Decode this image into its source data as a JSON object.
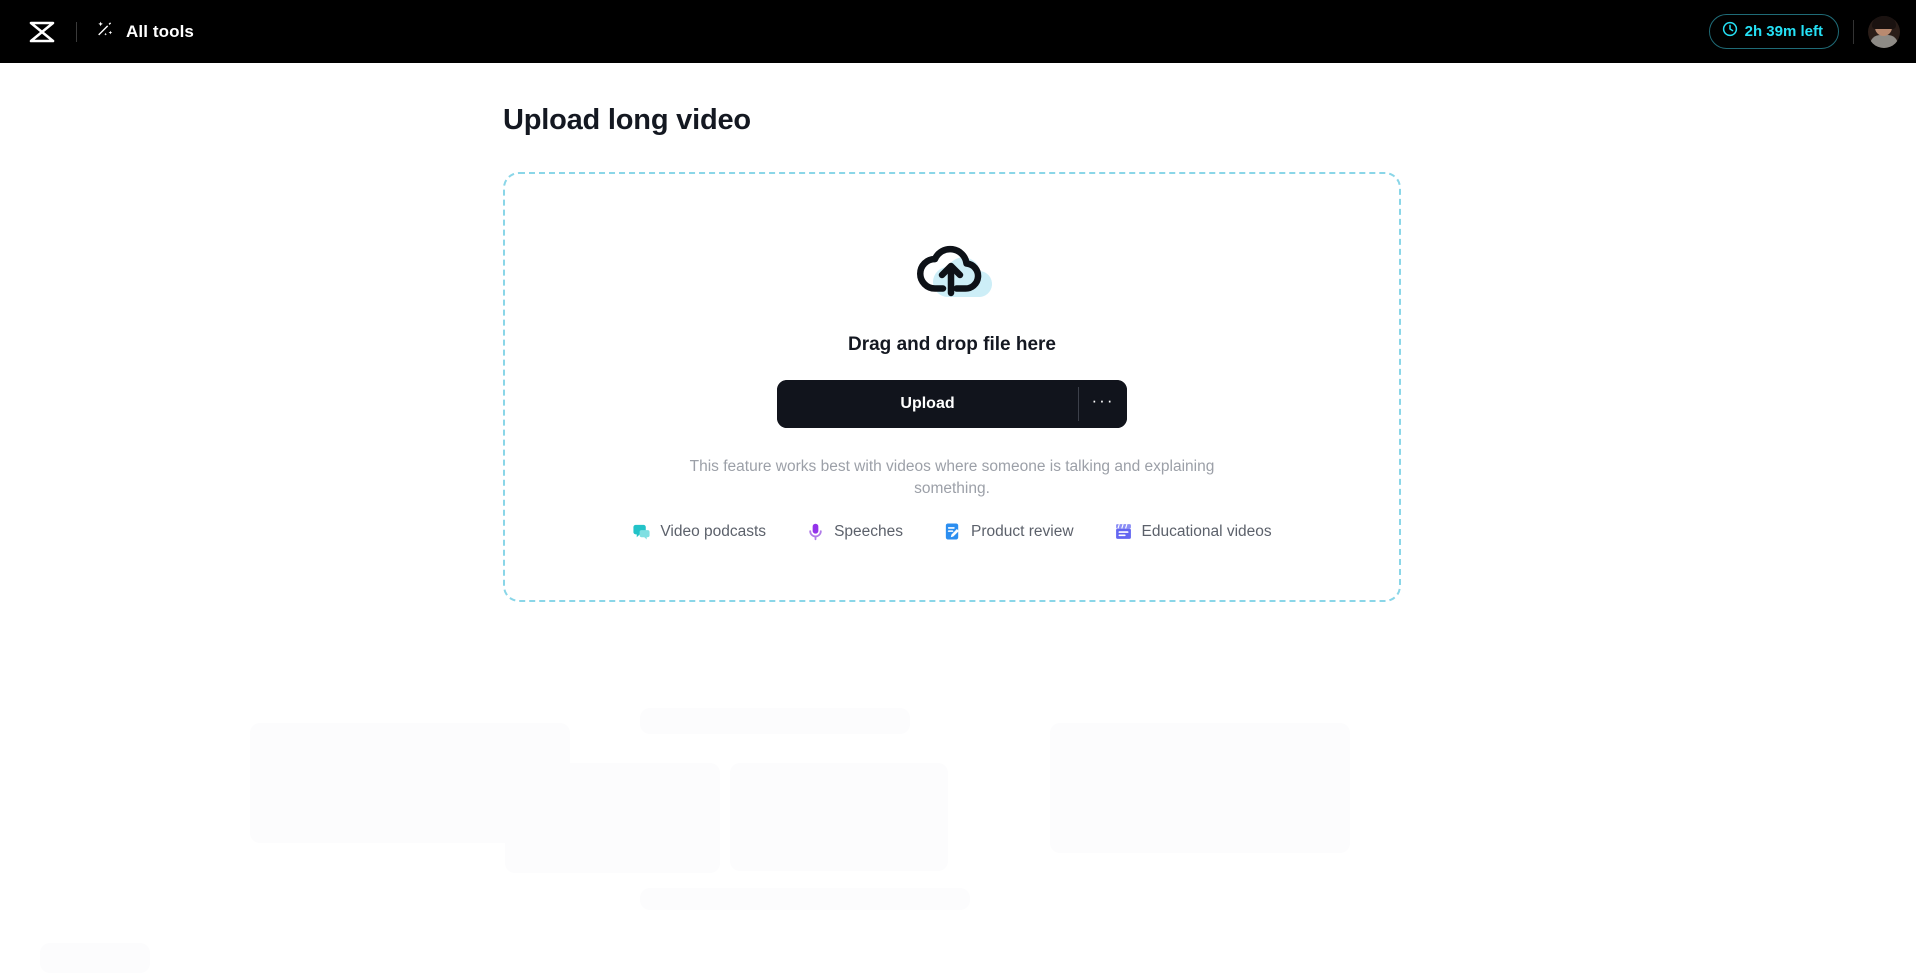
{
  "topbar": {
    "logo_icon": "capcut-logo-icon",
    "all_tools_label": "All tools",
    "all_tools_icon": "magic-wand-icon",
    "time_left_label": "2h 39m left",
    "clock_icon": "clock-icon",
    "avatar_icon": "user-avatar",
    "accent_color": "#25e0f5",
    "background_color": "#000000"
  },
  "page": {
    "title": "Upload long video"
  },
  "dropzone": {
    "upload_cloud_icon": "cloud-upload-icon",
    "heading": "Drag and drop file here",
    "upload_button_label": "Upload",
    "more_options_label": "···",
    "more_options_icon": "ellipsis-icon",
    "hint": "This feature works best with videos where someone is talking and explaining something.",
    "border_color": "#8ad6e8",
    "tags": [
      {
        "label": "Video podcasts",
        "icon": "speech-bubble-icon",
        "color": "#23c3c8"
      },
      {
        "label": "Speeches",
        "icon": "microphone-icon",
        "color": "#9333ea"
      },
      {
        "label": "Product review",
        "icon": "note-edit-icon",
        "color": "#2b8ef0"
      },
      {
        "label": "Educational videos",
        "icon": "clapperboard-icon",
        "color": "#6366f1"
      }
    ]
  }
}
